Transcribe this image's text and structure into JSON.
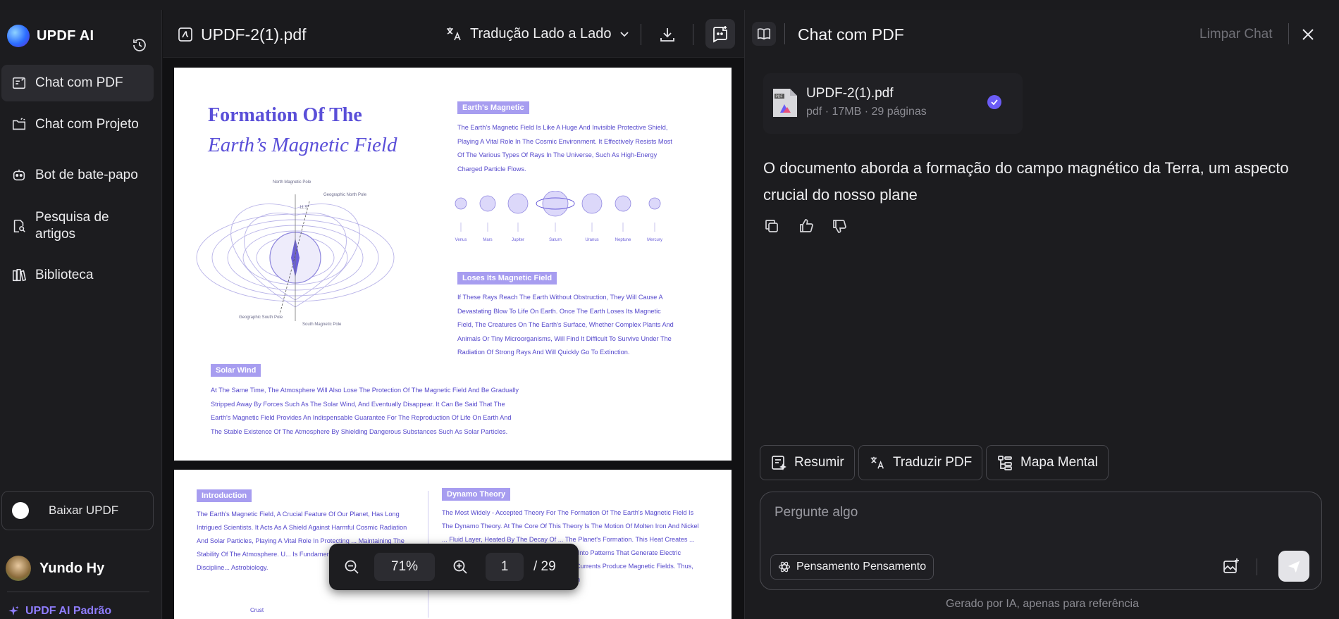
{
  "sidebar": {
    "brand": "UPDF AI",
    "items": [
      {
        "label": "Chat com PDF",
        "icon": "chat-pdf-icon"
      },
      {
        "label": "Chat com Projeto",
        "icon": "folder-chat-icon"
      },
      {
        "label": "Bot de bate-papo",
        "icon": "bot-icon"
      },
      {
        "label": "Pesquisa de artigos",
        "icon": "search-doc-icon"
      },
      {
        "label": "Biblioteca",
        "icon": "library-icon"
      }
    ],
    "download_label": "Baixar UPDF",
    "user_name": "Yundo Hy",
    "plan": "UPDF AI Padrão"
  },
  "pdf": {
    "file_name": "UPDF-2(1).pdf",
    "translate_mode": "Tradução Lado a Lado",
    "zoom": "71%",
    "page_current": "1",
    "page_total": "/ 29",
    "page1": {
      "title_line1": "Formation Of The",
      "title_line2": "Earth’s Magnetic Field",
      "diagram_labels": {
        "north_mag": "North Magnetic Pole",
        "geo_north": "Geographic North Pole",
        "geo_south": "Geographic South Pole",
        "south_mag": "South Magnetic Pole",
        "angle": "11.5°"
      },
      "planets": [
        "Venus",
        "Mars",
        "Jupiter",
        "Saturn",
        "Uranus",
        "Neptune",
        "Mercury"
      ],
      "section1_tag": "Earth's Magnetic",
      "section1_text": "The Earth's Magnetic Field Is Like A Huge And Invisible Protective Shield, Playing A Vital Role In The Cosmic Environment. It Effectively Resists Most Of The Various Types Of Rays In The Universe, Such As High-Energy Charged Particle Flows.",
      "section2_tag": "Loses Its Magnetic Field",
      "section2_text": "If These Rays Reach The Earth Without Obstruction, They Will Cause A Devastating Blow To Life On Earth. Once The Earth Loses Its Magnetic Field, The Creatures On The Earth's Surface, Whether Complex Plants And Animals Or Tiny Microorganisms, Will Find It Difficult To Survive Under The Radiation Of Strong Rays And Will Quickly Go To Extinction.",
      "section3_tag": "Solar Wind",
      "section3_text": "At The Same Time, The Atmosphere Will Also Lose The Protection Of The Magnetic Field And Be Gradually Stripped Away By Forces Such As The Solar Wind, And Eventually Disappear. It Can Be Said That The Earth's Magnetic Field Provides An Indispensable Guarantee For The Reproduction Of Life On Earth And The Stable Existence Of The Atmosphere By Shielding Dangerous Substances Such As Solar Particles."
    },
    "page2": {
      "intro_tag": "Introduction",
      "intro_text": "The Earth's Magnetic Field, A Crucial Feature Of Our Planet, Has Long Intrigued Scientists. It Acts As A Shield Against Harmful Cosmic Radiation And Solar Particles, Playing A Vital Role In Protecting ... Maintaining The Stability Of The Atmosphere. U... Is Fundamental To Various Scientific Discipline... Astrobiology.",
      "crust_label": "Crust",
      "dynamo_tag": "Dynamo Theory",
      "dynamo_text": "The Most Widely - Accepted Theory For The Formation Of The Earth's Magnetic Field Is The Dynamo Theory. At The Core Of This Theory Is The Motion Of Molten Iron And Nickel ... Fluid Layer, Heated By The Decay Of ... The Planet's Formation. This Heat Creates ... On These Convective Flows, Organizing Them Into Patterns That Generate Electric Currents. According To Ampere's Law, Electric Currents Produce Magnetic Fields. Thus, The Combination Of Convection And Rotation In"
    }
  },
  "chat": {
    "title": "Chat com PDF",
    "clear_label": "Limpar Chat",
    "file_name": "UPDF-2(1).pdf",
    "file_meta": "pdf · 17MB · 29 páginas",
    "answer": "O documento aborda a formação do campo magnético da Terra, um aspecto crucial do nosso plane",
    "quick_actions": [
      "Resumir",
      "Traduzir PDF",
      "Mapa Mental"
    ],
    "input_placeholder": "Pergunte algo",
    "thinking_label": "Pensamento Pensamento",
    "footnote": "Gerado por IA, apenas para referência"
  },
  "colors": {
    "accent": "#6b5cf6",
    "pdf_blue": "#5a4fd8",
    "tag_bg": "#a79df0"
  }
}
